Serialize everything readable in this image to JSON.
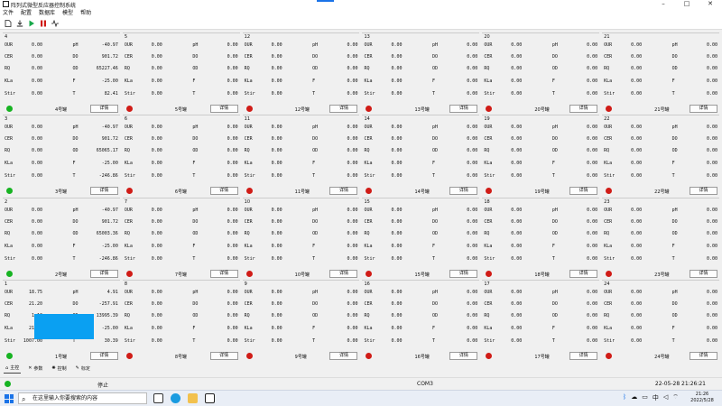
{
  "window": {
    "title": "阵列式微型反应器控制系统"
  },
  "menu": [
    "文件",
    "配置",
    "数据库",
    "模型",
    "帮助"
  ],
  "detail_label": "详情",
  "rows": [
    [
      {
        "num": "4",
        "left": [
          [
            "OUR",
            "0.00"
          ],
          [
            "CER",
            "0.00"
          ],
          [
            "RQ",
            "0.00"
          ],
          [
            "KLa",
            "0.00"
          ],
          [
            "Stir",
            "0.00"
          ]
        ],
        "right": [
          [
            "pH",
            "-40.97"
          ],
          [
            "DO",
            "901.72"
          ],
          [
            "OD",
            "65227.46"
          ],
          [
            "F",
            "-25.00"
          ],
          [
            "T",
            "82.41"
          ]
        ],
        "status": "green",
        "name": "4号罐"
      },
      {
        "num": "5",
        "left": [
          [
            "OUR",
            "0.00"
          ],
          [
            "CER",
            "0.00"
          ],
          [
            "RQ",
            "0.00"
          ],
          [
            "KLa",
            "0.00"
          ],
          [
            "Stir",
            "0.00"
          ]
        ],
        "right": [
          [
            "pH",
            "0.00"
          ],
          [
            "DO",
            "0.00"
          ],
          [
            "OD",
            "0.00"
          ],
          [
            "F",
            "0.00"
          ],
          [
            "T",
            "0.00"
          ]
        ],
        "status": "red",
        "name": "5号罐"
      },
      {
        "num": "12",
        "left": [
          [
            "OUR",
            "0.00"
          ],
          [
            "CER",
            "0.00"
          ],
          [
            "RQ",
            "0.00"
          ],
          [
            "KLa",
            "0.00"
          ],
          [
            "Stir",
            "0.00"
          ]
        ],
        "right": [
          [
            "pH",
            "0.00"
          ],
          [
            "DO",
            "0.00"
          ],
          [
            "OD",
            "0.00"
          ],
          [
            "F",
            "0.00"
          ],
          [
            "T",
            "0.00"
          ]
        ],
        "status": "red",
        "name": "12号罐"
      },
      {
        "num": "13",
        "left": [
          [
            "OUR",
            "0.00"
          ],
          [
            "CER",
            "0.00"
          ],
          [
            "RQ",
            "0.00"
          ],
          [
            "KLa",
            "0.00"
          ],
          [
            "Stir",
            "0.00"
          ]
        ],
        "right": [
          [
            "pH",
            "0.00"
          ],
          [
            "DO",
            "0.00"
          ],
          [
            "OD",
            "0.00"
          ],
          [
            "F",
            "0.00"
          ],
          [
            "T",
            "0.00"
          ]
        ],
        "status": "red",
        "name": "13号罐"
      },
      {
        "num": "20",
        "left": [
          [
            "OUR",
            "0.00"
          ],
          [
            "CER",
            "0.00"
          ],
          [
            "RQ",
            "0.00"
          ],
          [
            "KLa",
            "0.00"
          ],
          [
            "Stir",
            "0.00"
          ]
        ],
        "right": [
          [
            "pH",
            "0.00"
          ],
          [
            "DO",
            "0.00"
          ],
          [
            "OD",
            "0.00"
          ],
          [
            "F",
            "0.00"
          ],
          [
            "T",
            "0.00"
          ]
        ],
        "status": "red",
        "name": "20号罐"
      },
      {
        "num": "21",
        "left": [
          [
            "OUR",
            "0.00"
          ],
          [
            "CER",
            "0.00"
          ],
          [
            "RQ",
            "0.00"
          ],
          [
            "KLa",
            "0.00"
          ],
          [
            "Stir",
            "0.00"
          ]
        ],
        "right": [
          [
            "pH",
            "0.00"
          ],
          [
            "DO",
            "0.00"
          ],
          [
            "OD",
            "0.00"
          ],
          [
            "F",
            "0.00"
          ],
          [
            "T",
            "0.00"
          ]
        ],
        "status": "red",
        "name": "21号罐"
      }
    ],
    [
      {
        "num": "3",
        "left": [
          [
            "OUR",
            "0.00"
          ],
          [
            "CER",
            "0.00"
          ],
          [
            "RQ",
            "0.00"
          ],
          [
            "KLa",
            "0.00"
          ],
          [
            "Stir",
            "0.00"
          ]
        ],
        "right": [
          [
            "pH",
            "-40.97"
          ],
          [
            "DO",
            "901.72"
          ],
          [
            "OD",
            "65065.17"
          ],
          [
            "F",
            "-25.00"
          ],
          [
            "T",
            "-246.86"
          ]
        ],
        "status": "green",
        "name": "3号罐"
      },
      {
        "num": "6",
        "left": [
          [
            "OUR",
            "0.00"
          ],
          [
            "CER",
            "0.00"
          ],
          [
            "RQ",
            "0.00"
          ],
          [
            "KLa",
            "0.00"
          ],
          [
            "Stir",
            "0.00"
          ]
        ],
        "right": [
          [
            "pH",
            "0.00"
          ],
          [
            "DO",
            "0.00"
          ],
          [
            "OD",
            "0.00"
          ],
          [
            "F",
            "0.00"
          ],
          [
            "T",
            "0.00"
          ]
        ],
        "status": "red",
        "name": "6号罐"
      },
      {
        "num": "11",
        "left": [
          [
            "OUR",
            "0.00"
          ],
          [
            "CER",
            "0.00"
          ],
          [
            "RQ",
            "0.00"
          ],
          [
            "KLa",
            "0.00"
          ],
          [
            "Stir",
            "0.00"
          ]
        ],
        "right": [
          [
            "pH",
            "0.00"
          ],
          [
            "DO",
            "0.00"
          ],
          [
            "OD",
            "0.00"
          ],
          [
            "F",
            "0.00"
          ],
          [
            "T",
            "0.00"
          ]
        ],
        "status": "red",
        "name": "11号罐"
      },
      {
        "num": "14",
        "left": [
          [
            "OUR",
            "0.00"
          ],
          [
            "CER",
            "0.00"
          ],
          [
            "RQ",
            "0.00"
          ],
          [
            "KLa",
            "0.00"
          ],
          [
            "Stir",
            "0.00"
          ]
        ],
        "right": [
          [
            "pH",
            "0.00"
          ],
          [
            "DO",
            "0.00"
          ],
          [
            "OD",
            "0.00"
          ],
          [
            "F",
            "0.00"
          ],
          [
            "T",
            "0.00"
          ]
        ],
        "status": "red",
        "name": "14号罐"
      },
      {
        "num": "19",
        "left": [
          [
            "OUR",
            "0.00"
          ],
          [
            "CER",
            "0.00"
          ],
          [
            "RQ",
            "0.00"
          ],
          [
            "KLa",
            "0.00"
          ],
          [
            "Stir",
            "0.00"
          ]
        ],
        "right": [
          [
            "pH",
            "0.00"
          ],
          [
            "DO",
            "0.00"
          ],
          [
            "OD",
            "0.00"
          ],
          [
            "F",
            "0.00"
          ],
          [
            "T",
            "0.00"
          ]
        ],
        "status": "red",
        "name": "19号罐"
      },
      {
        "num": "22",
        "left": [
          [
            "OUR",
            "0.00"
          ],
          [
            "CER",
            "0.00"
          ],
          [
            "RQ",
            "0.00"
          ],
          [
            "KLa",
            "0.00"
          ],
          [
            "Stir",
            "0.00"
          ]
        ],
        "right": [
          [
            "pH",
            "0.00"
          ],
          [
            "DO",
            "0.00"
          ],
          [
            "OD",
            "0.00"
          ],
          [
            "F",
            "0.00"
          ],
          [
            "T",
            "0.00"
          ]
        ],
        "status": "red",
        "name": "22号罐"
      }
    ],
    [
      {
        "num": "2",
        "left": [
          [
            "OUR",
            "0.00"
          ],
          [
            "CER",
            "0.00"
          ],
          [
            "RQ",
            "0.00"
          ],
          [
            "KLa",
            "0.00"
          ],
          [
            "Stir",
            "0.00"
          ]
        ],
        "right": [
          [
            "pH",
            "-40.97"
          ],
          [
            "DO",
            "901.72"
          ],
          [
            "OD",
            "65003.36"
          ],
          [
            "F",
            "-25.00"
          ],
          [
            "T",
            "-246.86"
          ]
        ],
        "status": "green",
        "name": "2号罐"
      },
      {
        "num": "7",
        "left": [
          [
            "OUR",
            "0.00"
          ],
          [
            "CER",
            "0.00"
          ],
          [
            "RQ",
            "0.00"
          ],
          [
            "KLa",
            "0.00"
          ],
          [
            "Stir",
            "0.00"
          ]
        ],
        "right": [
          [
            "pH",
            "0.00"
          ],
          [
            "DO",
            "0.00"
          ],
          [
            "OD",
            "0.00"
          ],
          [
            "F",
            "0.00"
          ],
          [
            "T",
            "0.00"
          ]
        ],
        "status": "red",
        "name": "7号罐"
      },
      {
        "num": "10",
        "left": [
          [
            "OUR",
            "0.00"
          ],
          [
            "CER",
            "0.00"
          ],
          [
            "RQ",
            "0.00"
          ],
          [
            "KLa",
            "0.00"
          ],
          [
            "Stir",
            "0.00"
          ]
        ],
        "right": [
          [
            "pH",
            "0.00"
          ],
          [
            "DO",
            "0.00"
          ],
          [
            "OD",
            "0.00"
          ],
          [
            "F",
            "0.00"
          ],
          [
            "T",
            "0.00"
          ]
        ],
        "status": "red",
        "name": "10号罐"
      },
      {
        "num": "15",
        "left": [
          [
            "OUR",
            "0.00"
          ],
          [
            "CER",
            "0.00"
          ],
          [
            "RQ",
            "0.00"
          ],
          [
            "KLa",
            "0.00"
          ],
          [
            "Stir",
            "0.00"
          ]
        ],
        "right": [
          [
            "pH",
            "0.00"
          ],
          [
            "DO",
            "0.00"
          ],
          [
            "OD",
            "0.00"
          ],
          [
            "F",
            "0.00"
          ],
          [
            "T",
            "0.00"
          ]
        ],
        "status": "red",
        "name": "15号罐"
      },
      {
        "num": "18",
        "left": [
          [
            "OUR",
            "0.00"
          ],
          [
            "CER",
            "0.00"
          ],
          [
            "RQ",
            "0.00"
          ],
          [
            "KLa",
            "0.00"
          ],
          [
            "Stir",
            "0.00"
          ]
        ],
        "right": [
          [
            "pH",
            "0.00"
          ],
          [
            "DO",
            "0.00"
          ],
          [
            "OD",
            "0.00"
          ],
          [
            "F",
            "0.00"
          ],
          [
            "T",
            "0.00"
          ]
        ],
        "status": "red",
        "name": "18号罐"
      },
      {
        "num": "23",
        "left": [
          [
            "OUR",
            "0.00"
          ],
          [
            "CER",
            "0.00"
          ],
          [
            "RQ",
            "0.00"
          ],
          [
            "KLa",
            "0.00"
          ],
          [
            "Stir",
            "0.00"
          ]
        ],
        "right": [
          [
            "pH",
            "0.00"
          ],
          [
            "DO",
            "0.00"
          ],
          [
            "OD",
            "0.00"
          ],
          [
            "F",
            "0.00"
          ],
          [
            "T",
            "0.00"
          ]
        ],
        "status": "red",
        "name": "23号罐"
      }
    ],
    [
      {
        "num": "1",
        "left": [
          [
            "OUR",
            "18.75"
          ],
          [
            "CER",
            "21.20"
          ],
          [
            "RQ",
            "1.13"
          ],
          [
            "KLa",
            "21.39"
          ],
          [
            "Stir",
            "1007.00"
          ]
        ],
        "right": [
          [
            "pH",
            "4.91"
          ],
          [
            "DO",
            "-257.91"
          ],
          [
            "OD",
            "13995.39"
          ],
          [
            "F",
            "-25.00"
          ],
          [
            "T",
            "30.39"
          ]
        ],
        "status": "green",
        "name": "1号罐",
        "highlight": true
      },
      {
        "num": "8",
        "left": [
          [
            "OUR",
            "0.00"
          ],
          [
            "CER",
            "0.00"
          ],
          [
            "RQ",
            "0.00"
          ],
          [
            "KLa",
            "0.00"
          ],
          [
            "Stir",
            "0.00"
          ]
        ],
        "right": [
          [
            "pH",
            "0.00"
          ],
          [
            "DO",
            "0.00"
          ],
          [
            "OD",
            "0.00"
          ],
          [
            "F",
            "0.00"
          ],
          [
            "T",
            "0.00"
          ]
        ],
        "status": "red",
        "name": "8号罐"
      },
      {
        "num": "9",
        "left": [
          [
            "OUR",
            "0.00"
          ],
          [
            "CER",
            "0.00"
          ],
          [
            "RQ",
            "0.00"
          ],
          [
            "KLa",
            "0.00"
          ],
          [
            "Stir",
            "0.00"
          ]
        ],
        "right": [
          [
            "pH",
            "0.00"
          ],
          [
            "DO",
            "0.00"
          ],
          [
            "OD",
            "0.00"
          ],
          [
            "F",
            "0.00"
          ],
          [
            "T",
            "0.00"
          ]
        ],
        "status": "red",
        "name": "9号罐"
      },
      {
        "num": "16",
        "left": [
          [
            "OUR",
            "0.00"
          ],
          [
            "CER",
            "0.00"
          ],
          [
            "RQ",
            "0.00"
          ],
          [
            "KLa",
            "0.00"
          ],
          [
            "Stir",
            "0.00"
          ]
        ],
        "right": [
          [
            "pH",
            "0.00"
          ],
          [
            "DO",
            "0.00"
          ],
          [
            "OD",
            "0.00"
          ],
          [
            "F",
            "0.00"
          ],
          [
            "T",
            "0.00"
          ]
        ],
        "status": "red",
        "name": "16号罐"
      },
      {
        "num": "17",
        "left": [
          [
            "OUR",
            "0.00"
          ],
          [
            "CER",
            "0.00"
          ],
          [
            "RQ",
            "0.00"
          ],
          [
            "KLa",
            "0.00"
          ],
          [
            "Stir",
            "0.00"
          ]
        ],
        "right": [
          [
            "pH",
            "0.00"
          ],
          [
            "DO",
            "0.00"
          ],
          [
            "OD",
            "0.00"
          ],
          [
            "F",
            "0.00"
          ],
          [
            "T",
            "0.00"
          ]
        ],
        "status": "red",
        "name": "17号罐"
      },
      {
        "num": "24",
        "left": [
          [
            "OUR",
            "0.00"
          ],
          [
            "CER",
            "0.00"
          ],
          [
            "RQ",
            "0.00"
          ],
          [
            "KLa",
            "0.00"
          ],
          [
            "Stir",
            "0.00"
          ]
        ],
        "right": [
          [
            "pH",
            "0.00"
          ],
          [
            "DO",
            "0.00"
          ],
          [
            "OD",
            "0.00"
          ],
          [
            "F",
            "0.00"
          ],
          [
            "T",
            "0.00"
          ]
        ],
        "status": "red",
        "name": "24号罐"
      }
    ]
  ],
  "tabs": [
    {
      "label": "主控",
      "icon": "home-icon"
    },
    {
      "label": "参数",
      "icon": "tools-icon"
    },
    {
      "label": "控制",
      "icon": "gear-icon"
    },
    {
      "label": "标定",
      "icon": "pencil-icon"
    }
  ],
  "status": {
    "state": "停止",
    "port": "COM3",
    "datetime": "22-05-28 21:26:21"
  },
  "taskbar": {
    "search_placeholder": "在这里输入你要搜索的内容",
    "time": "21:26",
    "date": "2022/5/28"
  },
  "colors": {
    "ok": "#17b322",
    "error": "#d01c17",
    "highlight": "#0aa0f2",
    "accent": "#1a73e8"
  }
}
